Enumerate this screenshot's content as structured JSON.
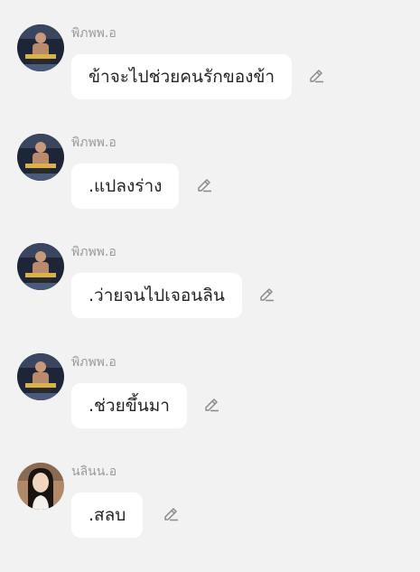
{
  "messages": [
    {
      "author": "พิภพพ.อ",
      "avatar": "man-with-boxing-belt-avatar",
      "text": "ข้าจะไปช่วยคนรักของข้า"
    },
    {
      "author": "พิภพพ.อ",
      "avatar": "man-with-boxing-belt-avatar",
      "text": ".แปลงร่าง"
    },
    {
      "author": "พิภพพ.อ",
      "avatar": "man-with-boxing-belt-avatar",
      "text": ".ว่ายจนไปเจอนลิน"
    },
    {
      "author": "พิภพพ.อ",
      "avatar": "man-with-boxing-belt-avatar",
      "text": ".ช่วยขึ้นมา"
    },
    {
      "author": "นลินน.อ",
      "avatar": "woman-long-hair-avatar",
      "text": ".สลบ"
    }
  ],
  "icons": {
    "edit": "pencil-icon"
  },
  "colors": {
    "background": "#f2f2f2",
    "bubble": "#ffffff",
    "author": "#9a9a9a",
    "text": "#222222",
    "icon": "#8a8a8a"
  }
}
